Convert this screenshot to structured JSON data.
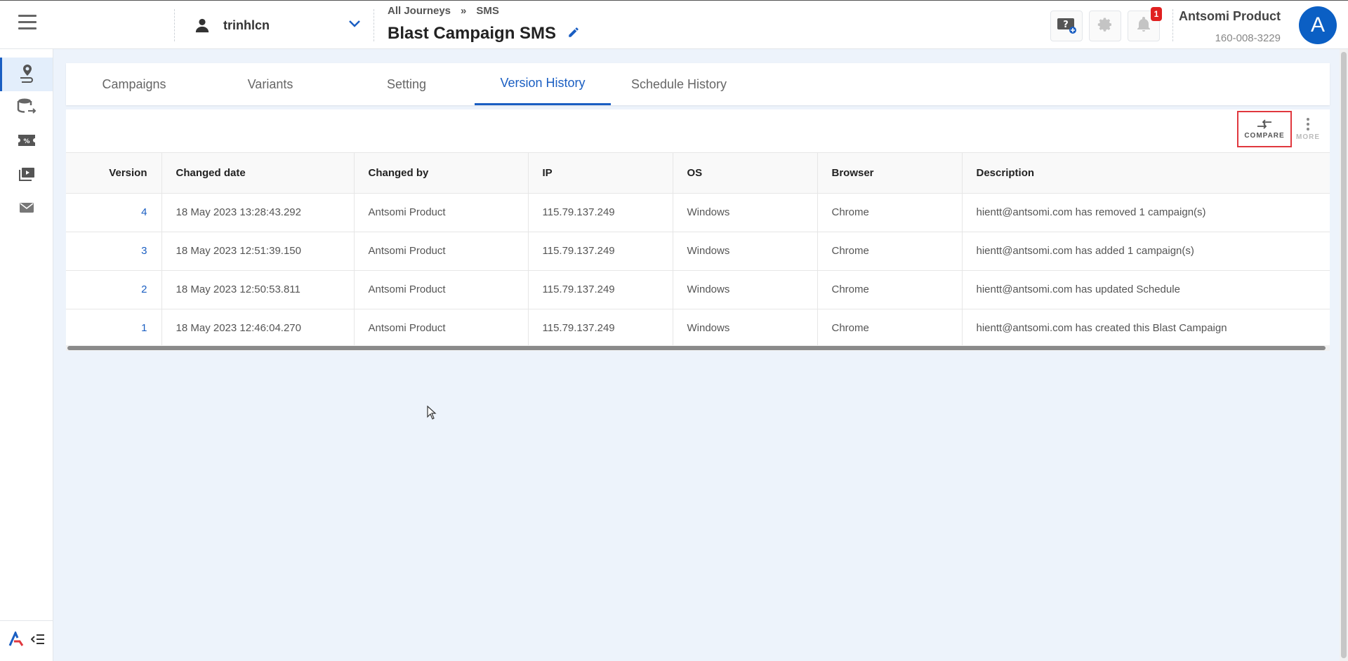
{
  "account": {
    "name": "trinhlcn"
  },
  "breadcrumb": {
    "root": "All Journeys",
    "separator": "»",
    "current": "SMS"
  },
  "page": {
    "title": "Blast Campaign SMS"
  },
  "header": {
    "notification_count": "1",
    "user_name": "Antsomi Product",
    "user_id": "160-008-3229",
    "avatar_letter": "A"
  },
  "tabs": [
    {
      "label": "Campaigns"
    },
    {
      "label": "Variants"
    },
    {
      "label": "Setting"
    },
    {
      "label": "Version History"
    },
    {
      "label": "Schedule History"
    }
  ],
  "toolbar": {
    "compare_label": "COMPARE",
    "more_label": "MORE"
  },
  "table": {
    "columns": [
      "Version",
      "Changed date",
      "Changed by",
      "IP",
      "OS",
      "Browser",
      "Description"
    ],
    "rows": [
      [
        "4",
        "18 May 2023 13:28:43.292",
        "Antsomi Product",
        "115.79.137.249",
        "Windows",
        "Chrome",
        "hientt@antsomi.com has removed 1 campaign(s)"
      ],
      [
        "3",
        "18 May 2023 12:51:39.150",
        "Antsomi Product",
        "115.79.137.249",
        "Windows",
        "Chrome",
        "hientt@antsomi.com has added 1 campaign(s)"
      ],
      [
        "2",
        "18 May 2023 12:50:53.811",
        "Antsomi Product",
        "115.79.137.249",
        "Windows",
        "Chrome",
        "hientt@antsomi.com has updated Schedule"
      ],
      [
        "1",
        "18 May 2023 12:46:04.270",
        "Antsomi Product",
        "115.79.137.249",
        "Windows",
        "Chrome",
        "hientt@antsomi.com has created this Blast Campaign"
      ]
    ]
  },
  "colors": {
    "accent": "#1a5ec2",
    "highlight": "#e0383e",
    "badge": "#e02020"
  },
  "icons": {
    "menu": "hamburger-icon",
    "nav": [
      "journey-icon",
      "data-flow-icon",
      "promotion-icon",
      "media-icon",
      "email-icon"
    ],
    "header": [
      "help-ticket-icon",
      "gear-icon",
      "bell-icon"
    ]
  }
}
